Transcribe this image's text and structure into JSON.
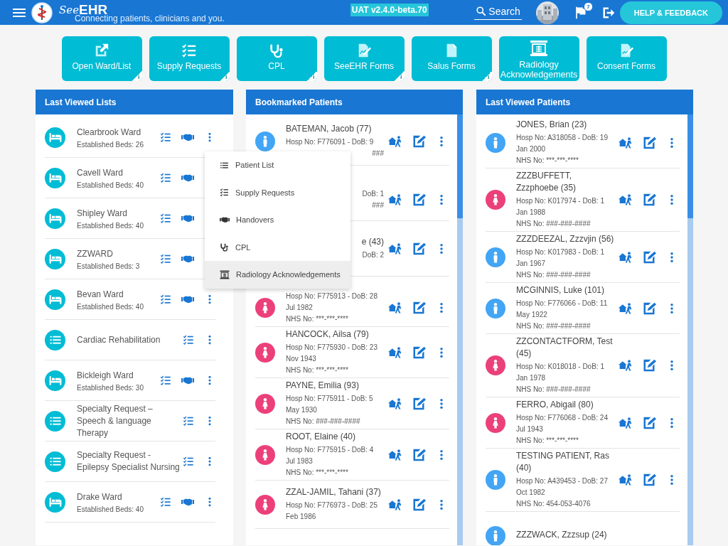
{
  "header": {
    "brand_prefix": "See",
    "brand_suffix": "EHR",
    "tagline": "Connecting patients, clinicians and you.",
    "environment": "UAT v2.4.0-beta.70",
    "search": "Search",
    "notifications": "7",
    "help_button": "HELP & FEEDBACK"
  },
  "tiles": [
    {
      "kind": "open",
      "label": "Open Ward/List",
      "info": "i"
    },
    {
      "kind": "supply",
      "label": "Supply Requests",
      "info": "i"
    },
    {
      "kind": "cpl",
      "label": "CPL",
      "info": "i"
    },
    {
      "kind": "forms",
      "label": "SeeEHR Forms",
      "info": "i"
    },
    {
      "kind": "doc",
      "label": "Salus Forms",
      "info": "i"
    },
    {
      "kind": "radiology",
      "label": "Radiology Acknowledgements"
    },
    {
      "kind": "consent",
      "label": "Consent Forms"
    }
  ],
  "last_viewed_lists": {
    "title": "Last Viewed Lists",
    "items": [
      {
        "kind": "ward",
        "name": "Clearbrook Ward",
        "beds": "Established Beds: 26",
        "more": true
      },
      {
        "kind": "ward",
        "name": "Cavell Ward",
        "beds": "Established Beds: 40",
        "more": false
      },
      {
        "kind": "ward",
        "name": "Shipley Ward",
        "beds": "Established Beds: 40",
        "more": false
      },
      {
        "kind": "ward",
        "name": "ZZWARD",
        "beds": "Established Beds: 3",
        "more": false
      },
      {
        "kind": "ward",
        "name": "Bevan Ward",
        "beds": "Established Beds: 40",
        "more": true
      },
      {
        "kind": "list",
        "name": "Cardiac Rehabilitation",
        "more": true
      },
      {
        "kind": "ward",
        "name": "Bickleigh Ward",
        "beds": "Established Beds: 30",
        "more": true
      },
      {
        "kind": "list",
        "name": "Specialty Request – Speech & language Therapy",
        "more": true
      },
      {
        "kind": "list",
        "name": "Specialty Request - Epilepsy Specialist Nursing",
        "more": true
      },
      {
        "kind": "ward",
        "name": "Drake Ward",
        "beds": "Established Beds: 40",
        "more": true
      }
    ]
  },
  "bookmarked_patients": {
    "title": "Bookmarked Patients",
    "patients": [
      {
        "kind": "male",
        "color": "#42a5f5",
        "lines": [
          {
            "kind": "name",
            "text": "BATEMAN, Jacob (77)",
            "covered": false
          },
          {
            "kind": "detail",
            "text": "Hosp No: F776091 - DoB: 9",
            "covered": false
          },
          {
            "kind": "detail",
            "text": "###",
            "covered": true
          }
        ]
      },
      {
        "lines": [
          {
            "kind": "detail",
            "text": "DoB: 1",
            "covered": true
          },
          {
            "kind": "detail",
            "text": "###",
            "covered": true
          }
        ]
      },
      {
        "lines": [
          {
            "kind": "name",
            "text": "e (43)",
            "covered": true
          },
          {
            "kind": "detail",
            "text": "DoB: 2",
            "covered": true
          }
        ]
      },
      {
        "kind": "female",
        "color": "#ec407a",
        "lines": [
          {
            "kind": "detail",
            "text": "Hosp No: F775913 - DoB: 28 Jul 1982",
            "covered": false
          },
          {
            "kind": "detail",
            "text": "NHS No: ***-***-****",
            "covered": false
          }
        ]
      },
      {
        "kind": "female",
        "color": "#ec407a",
        "lines": [
          {
            "kind": "name",
            "text": "HANCOCK, Ailsa (79)",
            "covered": false
          },
          {
            "kind": "detail",
            "text": "Hosp No: F775930 - DoB: 23 Nov 1943",
            "covered": false
          },
          {
            "kind": "detail",
            "text": "NHS No: ***-***-****",
            "covered": false
          }
        ]
      },
      {
        "kind": "female",
        "color": "#ec407a",
        "lines": [
          {
            "kind": "name",
            "text": "PAYNE, Emilia (93)",
            "covered": false
          },
          {
            "kind": "detail",
            "text": "Hosp No: F775911 - DoB: 5 May 1930",
            "covered": false
          },
          {
            "kind": "detail",
            "text": "NHS No: ###-###-####",
            "covered": false
          }
        ]
      },
      {
        "kind": "female",
        "color": "#ec407a",
        "lines": [
          {
            "kind": "name",
            "text": "ROOT, Elaine (40)",
            "covered": false
          },
          {
            "kind": "detail",
            "text": "Hosp No: F775915 - DoB: 4 Jul 1983",
            "covered": false
          },
          {
            "kind": "detail",
            "text": "NHS No: ***-***-****",
            "covered": false
          }
        ]
      },
      {
        "kind": "female",
        "color": "#ec407a",
        "lines": [
          {
            "kind": "name",
            "text": "ZZAL-JAMIL, Tahani (37)",
            "covered": false
          },
          {
            "kind": "detail",
            "text": "Hosp No: F776973 - DoB: 25 Feb 1986",
            "covered": false
          }
        ]
      }
    ]
  },
  "last_viewed_patients": {
    "title": "Last Viewed Patients",
    "patients": [
      {
        "kind": "male",
        "color": "#42a5f5",
        "lines": [
          {
            "kind": "name",
            "text": "JONES, Brian (23)",
            "covered": false
          },
          {
            "kind": "detail",
            "text": "Hosp No: A318058 - DoB: 19 Jan 2000",
            "covered": false
          },
          {
            "kind": "detail",
            "text": "NHS No: ***-***-****",
            "covered": false
          }
        ]
      },
      {
        "kind": "female",
        "color": "#ec407a",
        "lines": [
          {
            "kind": "name",
            "text": "ZZZBUFFETT, Zzzphoebe (35)",
            "covered": false
          },
          {
            "kind": "detail",
            "text": "Hosp No: K017974 - DoB: 1 Jan 1988",
            "covered": false
          },
          {
            "kind": "detail",
            "text": "NHS No: ###-###-####",
            "covered": false
          }
        ]
      },
      {
        "kind": "male",
        "color": "#42a5f5",
        "lines": [
          {
            "kind": "name",
            "text": "ZZZDEEZAL, Zzzvjin (56)",
            "covered": false
          },
          {
            "kind": "detail",
            "text": "Hosp No: K017983 - DoB: 1 Jan 1967",
            "covered": false
          },
          {
            "kind": "detail",
            "text": "NHS No: ###-###-####",
            "covered": false
          }
        ]
      },
      {
        "kind": "male",
        "color": "#42a5f5",
        "lines": [
          {
            "kind": "name",
            "text": "MCGINNIS, Luke (101)",
            "covered": false
          },
          {
            "kind": "detail",
            "text": "Hosp No: F776066 - DoB: 11 May 1922",
            "covered": false
          },
          {
            "kind": "detail",
            "text": "NHS No: ###-###-####",
            "covered": false
          }
        ]
      },
      {
        "kind": "female",
        "color": "#ec407a",
        "lines": [
          {
            "kind": "name",
            "text": "ZZCONTACTFORM, Test (45)",
            "covered": false
          },
          {
            "kind": "detail",
            "text": "Hosp No: K018018 - DoB: 1 Jan 1978",
            "covered": false
          },
          {
            "kind": "detail",
            "text": "NHS No: ###-###-####",
            "covered": false
          }
        ]
      },
      {
        "kind": "female",
        "color": "#ec407a",
        "lines": [
          {
            "kind": "name",
            "text": "FERRO, Abigail (80)",
            "covered": false
          },
          {
            "kind": "detail",
            "text": "Hosp No: F776068 - DoB: 24 Jul 1943",
            "covered": false
          },
          {
            "kind": "detail",
            "text": "NHS No: ***-***-****",
            "covered": false
          }
        ]
      },
      {
        "kind": "male",
        "color": "#42a5f5",
        "lines": [
          {
            "kind": "name",
            "text": "TESTING PATIENT, Ras (40)",
            "covered": false
          },
          {
            "kind": "detail",
            "text": "Hosp No: A439453 - DoB: 27 Oct 1982",
            "covered": false
          },
          {
            "kind": "detail",
            "text": "NHS No: 454-053-4076",
            "covered": false
          }
        ]
      },
      {
        "kind": "male",
        "color": "#42a5f5",
        "lines": [
          {
            "kind": "name",
            "text": "ZZZWACK, Zzzsup (24)",
            "covered": false
          }
        ]
      }
    ]
  },
  "context_menu": {
    "items": [
      {
        "kind": "patients",
        "label": "Patient List",
        "selected": false
      },
      {
        "kind": "supply",
        "label": "Supply Requests",
        "selected": false
      },
      {
        "kind": "handover",
        "label": "Handovers",
        "selected": false
      },
      {
        "kind": "cpl",
        "label": "CPL",
        "selected": false
      },
      {
        "kind": "radiology",
        "label": "Radiology Acknowledgements",
        "selected": true
      }
    ]
  }
}
